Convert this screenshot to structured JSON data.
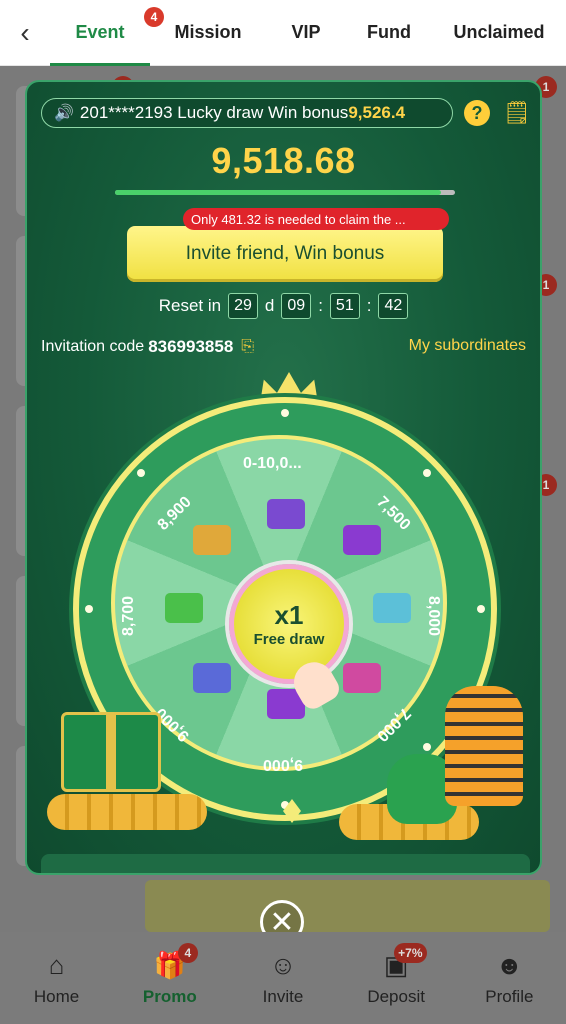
{
  "nav": {
    "back_icon": "chevron-left-icon",
    "tabs": [
      {
        "label": "Event",
        "badge": "4",
        "active": true
      },
      {
        "label": "Mission"
      },
      {
        "label": "VIP"
      },
      {
        "label": "Fund"
      },
      {
        "label": "Unclaimed"
      }
    ]
  },
  "bg_badges": [
    "1",
    "1",
    "1",
    "1"
  ],
  "modal": {
    "ticker_text": "201****2193 Lucky draw Win bonus",
    "ticker_amount": "9,526.4",
    "total_amount": "9,518.68",
    "progress_fraction": 0.96,
    "tip": "Only 481.32 is needed to claim the ...",
    "invite_button": "Invite friend, Win bonus",
    "reset": {
      "label": "Reset in",
      "days": "29",
      "d_label": "d",
      "hours": "09",
      "minutes": "51",
      "seconds": "42",
      "sep": ":"
    },
    "invitation_label": "Invitation code",
    "invitation_code": "836993858",
    "subordinates_link": "My subordinates",
    "wheel": {
      "segments": [
        "0-10,0...",
        "7,500",
        "8,000",
        "7,000",
        "9,000",
        "9,000",
        "8,700",
        "8,900"
      ],
      "hub_count": "x1",
      "hub_text": "Free draw"
    }
  },
  "close_icon": "close-icon",
  "bottom_nav": [
    {
      "label": "Home",
      "icon": "home-icon"
    },
    {
      "label": "Promo",
      "icon": "gift-icon",
      "badge": "4",
      "active": true
    },
    {
      "label": "Invite",
      "icon": "users-icon"
    },
    {
      "label": "Deposit",
      "icon": "wallet-icon",
      "badge": "+7%"
    },
    {
      "label": "Profile",
      "icon": "user-icon"
    }
  ]
}
